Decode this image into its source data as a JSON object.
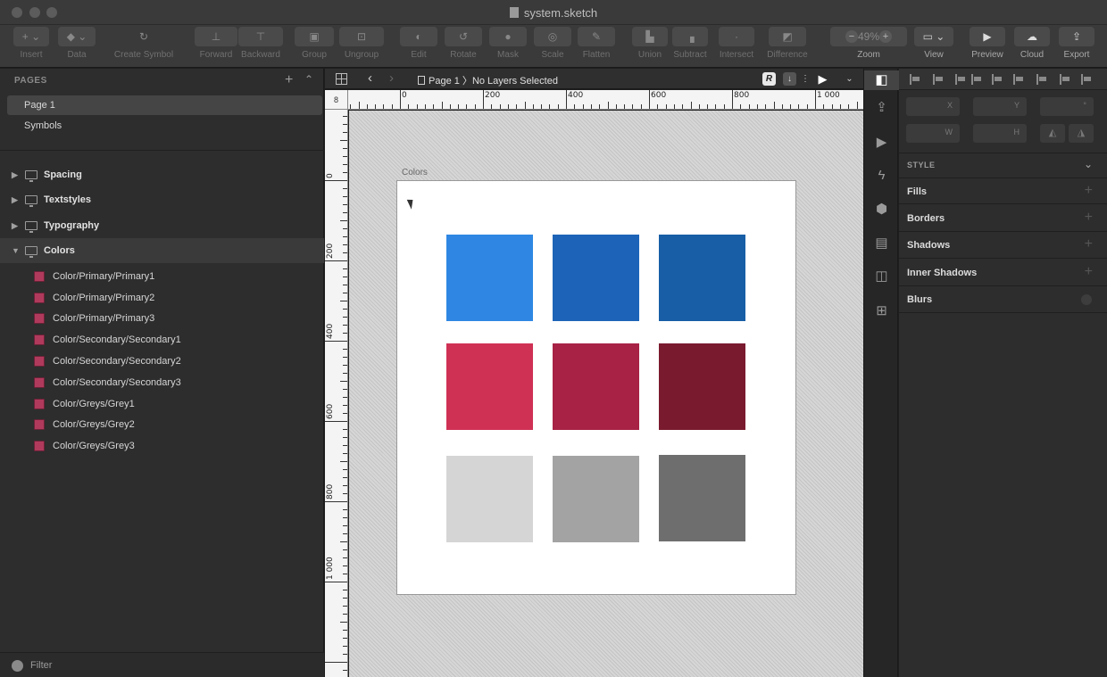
{
  "window": {
    "title": "system.sketch"
  },
  "toolbar": {
    "insert": "Insert",
    "data": "Data",
    "create_symbol": "Create Symbol",
    "forward": "Forward",
    "backward": "Backward",
    "group": "Group",
    "ungroup": "Ungroup",
    "edit": "Edit",
    "rotate": "Rotate",
    "mask": "Mask",
    "scale": "Scale",
    "flatten": "Flatten",
    "union": "Union",
    "subtract": "Subtract",
    "intersect": "Intersect",
    "difference": "Difference",
    "zoom": "Zoom",
    "zoom_value": "49%",
    "view": "View",
    "preview": "Preview",
    "cloud": "Cloud",
    "export": "Export"
  },
  "sidebar": {
    "pages_header": "PAGES",
    "pages": [
      {
        "label": "Page 1",
        "selected": true
      },
      {
        "label": "Symbols",
        "selected": false
      }
    ],
    "artboards": [
      {
        "label": "Spacing",
        "open": false
      },
      {
        "label": "Textstyles",
        "open": false
      },
      {
        "label": "Typography",
        "open": false
      },
      {
        "label": "Colors",
        "open": true
      }
    ],
    "layers": [
      "Color/Primary/Primary1",
      "Color/Primary/Primary2",
      "Color/Primary/Primary3",
      "Color/Secondary/Secondary1",
      "Color/Secondary/Secondary2",
      "Color/Secondary/Secondary3",
      "Color/Greys/Grey1",
      "Color/Greys/Grey2",
      "Color/Greys/Grey3"
    ],
    "filter": "Filter"
  },
  "canvas_header": {
    "page": "Page 1",
    "selection": "No Layers Selected"
  },
  "rulers": {
    "corner": "8",
    "h_labels": [
      "0",
      "200",
      "400",
      "600",
      "800",
      "1 000"
    ],
    "v_labels": [
      "0",
      "200",
      "400",
      "600",
      "800",
      "1 000"
    ]
  },
  "artboard": {
    "label": "Colors",
    "swatches": [
      {
        "name": "Primary1",
        "color": "#2f87e3"
      },
      {
        "name": "Primary2",
        "color": "#1d64b8"
      },
      {
        "name": "Primary3",
        "color": "#175ea6"
      },
      {
        "name": "Secondary1",
        "color": "#cf3155"
      },
      {
        "name": "Secondary2",
        "color": "#a72245"
      },
      {
        "name": "Secondary3",
        "color": "#7a1a2f"
      },
      {
        "name": "Grey1",
        "color": "#d5d5d5"
      },
      {
        "name": "Grey2",
        "color": "#a3a3a3"
      },
      {
        "name": "Grey3",
        "color": "#6e6e6e"
      }
    ]
  },
  "inspector": {
    "field_x": "X",
    "field_y": "Y",
    "field_w": "W",
    "field_h": "H",
    "style_header": "STYLE",
    "sections": [
      "Fills",
      "Borders",
      "Shadows",
      "Inner Shadows",
      "Blurs"
    ]
  }
}
